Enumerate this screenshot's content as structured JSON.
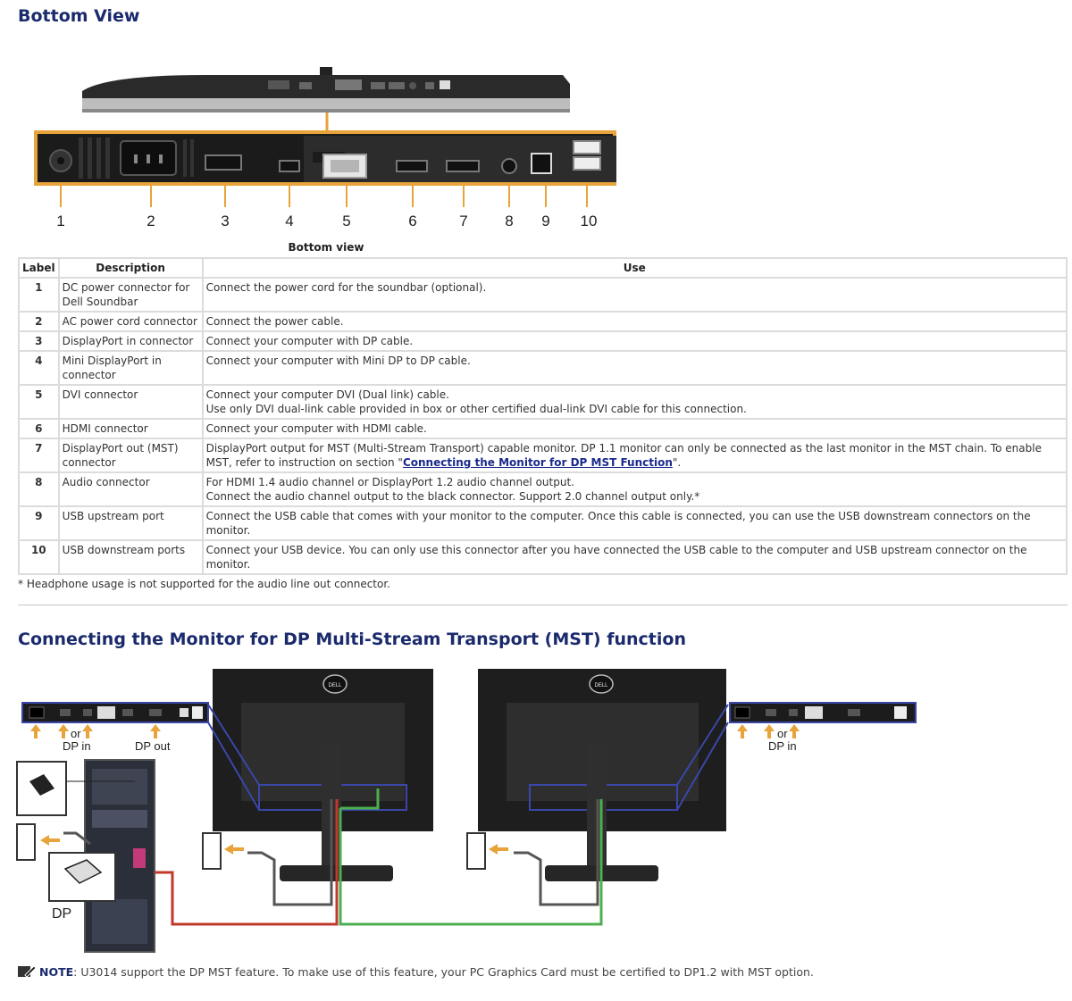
{
  "section1": {
    "title": "Bottom View",
    "caption": "Bottom view"
  },
  "callouts": [
    "1",
    "2",
    "3",
    "4",
    "5",
    "6",
    "7",
    "8",
    "9",
    "10"
  ],
  "table": {
    "headers": {
      "label": "Label",
      "description": "Description",
      "use": "Use"
    },
    "rows": [
      {
        "label": "1",
        "description": "DC power connector for Dell Soundbar",
        "use": [
          "Connect the power cord for the soundbar (optional)."
        ]
      },
      {
        "label": "2",
        "description": "AC power cord connector",
        "use": [
          "Connect the power cable."
        ]
      },
      {
        "label": "3",
        "description": "DisplayPort in connector",
        "use": [
          "Connect your computer with DP cable."
        ]
      },
      {
        "label": "4",
        "description": "Mini DisplayPort in connector",
        "use": [
          "Connect your computer with Mini DP to DP cable."
        ]
      },
      {
        "label": "5",
        "description": "DVI connector",
        "use": [
          "Connect your computer DVI (Dual link) cable.",
          "Use only DVI dual-link cable provided in box or other certified dual-link DVI cable for this connection."
        ]
      },
      {
        "label": "6",
        "description": "HDMI connector",
        "use": [
          "Connect your computer with HDMI cable."
        ]
      },
      {
        "label": "7",
        "description": "DisplayPort out (MST) connector",
        "use_pre": "DisplayPort output for MST (Multi-Stream Transport) capable monitor. DP 1.1 monitor can only be connected as the last monitor in the MST chain. To enable MST, refer to instruction on section \"",
        "use_link": "Connecting the Monitor for DP MST Function",
        "use_post": "\"."
      },
      {
        "label": "8",
        "description": "Audio connector",
        "use": [
          "For HDMI 1.4 audio channel or DisplayPort 1.2 audio channel output.",
          "Connect the audio channel output to the black connector. Support 2.0 channel output only.*"
        ]
      },
      {
        "label": "9",
        "description": "USB upstream port",
        "use": [
          "Connect the USB cable that comes with your monitor to the computer. Once this cable is connected, you can use the USB downstream connectors on the monitor."
        ]
      },
      {
        "label": "10",
        "description": "USB downstream ports",
        "use": [
          "Connect your USB device. You can only use this connector after you have connected the USB cable to the computer and USB upstream connector on the monitor."
        ]
      }
    ]
  },
  "footnote": "* Headphone usage is not supported for the audio line out connector.",
  "section2": {
    "title": "Connecting the Monitor for DP Multi-Stream Transport (MST) function"
  },
  "diagram": {
    "or_left": "or",
    "dp_in_left": "DP in",
    "dp_out": "DP out",
    "or_right": "or",
    "dp_in_right": "DP in",
    "dp_label": "DP",
    "brand": "DELL"
  },
  "note": {
    "label": "NOTE",
    "text": ": U3014 support the DP MST feature. To make use of this feature, your PC Graphics Card must be certified to DP1.2 with MST option."
  },
  "colors": {
    "heading": "#1a2a6c",
    "frame": "#e8a33a",
    "cable_red": "#c0392b",
    "cable_green": "#4caf50",
    "link": "#1a2a8c"
  }
}
